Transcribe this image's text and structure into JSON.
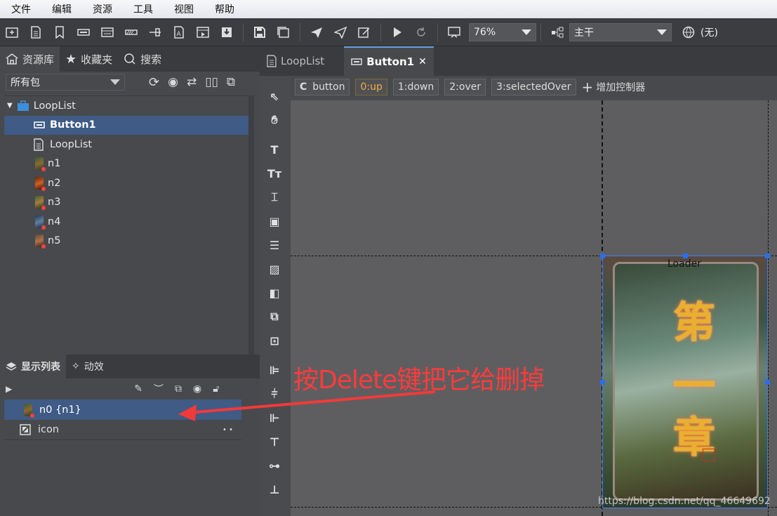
{
  "menu": [
    "文件",
    "编辑",
    "资源",
    "工具",
    "视图",
    "帮助"
  ],
  "toolbar": {
    "zoom": "76%",
    "branch": "主干",
    "lang": "(无)"
  },
  "left_tabs": {
    "library": "资源库",
    "favorites": "收藏夹",
    "search": "搜索"
  },
  "package_filter": "所有包",
  "tree": {
    "root": "LoopList",
    "items": [
      {
        "label": "Button1",
        "type": "button",
        "selected": true
      },
      {
        "label": "LoopList",
        "type": "component"
      },
      {
        "label": "n1",
        "type": "image"
      },
      {
        "label": "n2",
        "type": "image"
      },
      {
        "label": "n3",
        "type": "image"
      },
      {
        "label": "n4",
        "type": "image"
      },
      {
        "label": "n5",
        "type": "image"
      }
    ]
  },
  "doc_tabs": [
    {
      "label": "LoopList",
      "active": false
    },
    {
      "label": "Button1",
      "active": true,
      "close": "✕"
    }
  ],
  "controller": {
    "name": "button",
    "states": [
      "0:up",
      "1:down",
      "2:over",
      "3:selectedOver"
    ],
    "add_label": "增加控制器"
  },
  "bottom_tabs": {
    "display_list": "显示列表",
    "effects": "动效"
  },
  "display_list": [
    {
      "label": "n0 {n1}",
      "selected": true
    },
    {
      "label": "icon",
      "selected": false,
      "dots": "•   •"
    }
  ],
  "canvas": {
    "loader_label": "Loader",
    "card_title_chars": [
      "第",
      "一",
      "章"
    ],
    "annotation": "按Delete键把它给删掉",
    "watermark": "https://blog.csdn.net/qq_46649692"
  },
  "colors": {
    "selection": "#3f5b86",
    "annotation": "#ff3b3b",
    "handle": "#2a6ef0",
    "active_state": "#f0b040"
  }
}
